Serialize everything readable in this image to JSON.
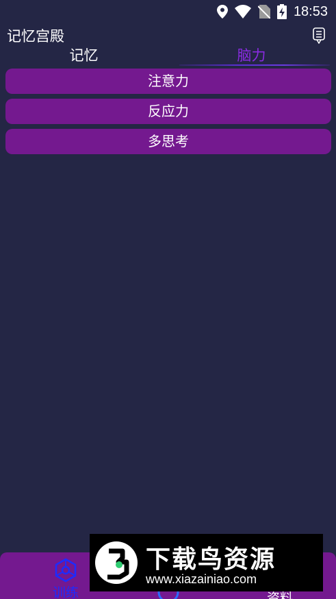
{
  "status_bar": {
    "time": "18:53"
  },
  "app": {
    "title": "记忆宫殿"
  },
  "tabs": [
    {
      "label": "记忆",
      "active": false
    },
    {
      "label": "脑力",
      "active": true
    }
  ],
  "list_items": [
    {
      "label": "注意力"
    },
    {
      "label": "反应力"
    },
    {
      "label": "多思考"
    }
  ],
  "bottom_nav": {
    "train_label": "训练",
    "data_label": "资料"
  },
  "watermark": {
    "brand": "下载鸟资源",
    "url": "www.xiazainiao.com"
  },
  "colors": {
    "background": "#242645",
    "accent_purple": "#74198f",
    "active_tab": "#8a2be2",
    "nav_active": "#1d2bff"
  }
}
